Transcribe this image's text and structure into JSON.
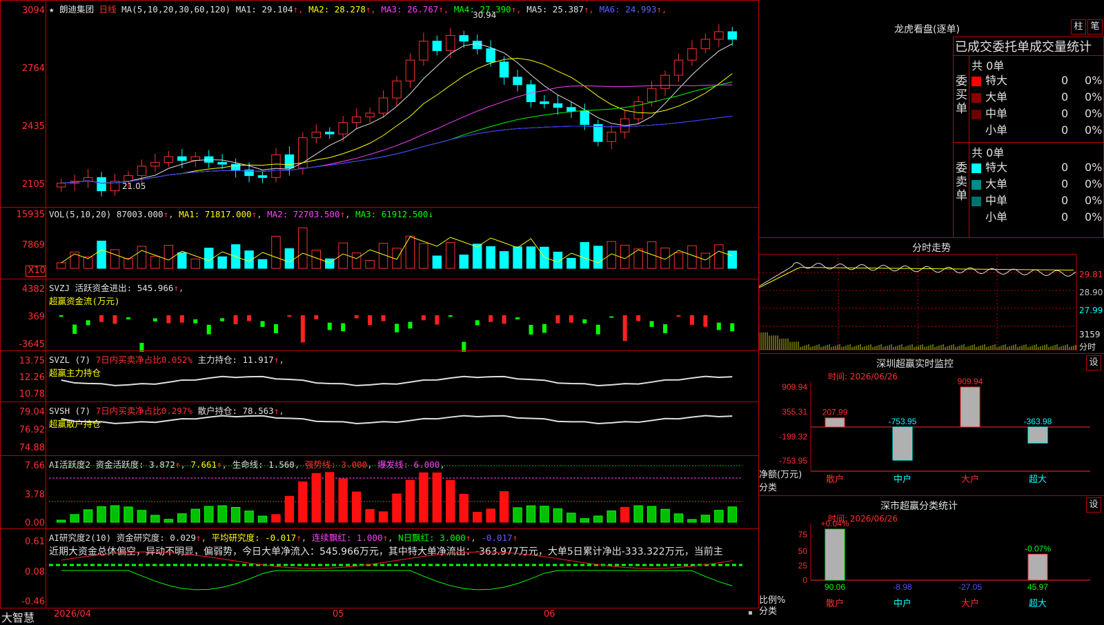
{
  "stock": {
    "star": "★",
    "name": "朗迪集团",
    "period": "日线"
  },
  "main": {
    "ma_label": "MA(5,10,20,30,60,120)",
    "ma": [
      {
        "k": "MA1:",
        "v": "29.104",
        "cls": "w"
      },
      {
        "k": "MA2:",
        "v": "28.278",
        "cls": "y"
      },
      {
        "k": "MA3:",
        "v": "26.767",
        "cls": "m"
      },
      {
        "k": "MA4:",
        "v": "27.390",
        "cls": "g"
      },
      {
        "k": "MA5:",
        "v": "25.387",
        "cls": "w"
      },
      {
        "k": "MA6:",
        "v": "24.993",
        "cls": "b"
      }
    ],
    "yticks": [
      "3094",
      "2764",
      "2435",
      "2105"
    ],
    "high_label": "30.94",
    "low_label": "21.05"
  },
  "vol": {
    "label": "VOL(5,10,20)",
    "val": "87003.000",
    "ma1": "MA1: 71817.000",
    "ma2": "MA2: 72703.500",
    "ma3": "MA3: 61912.500",
    "yticks": [
      "15935",
      "7869"
    ],
    "unit": "X10"
  },
  "svzj": {
    "label": "SVZJ",
    "title": "活跃资金进出: 545.966",
    "sub": "超赢资金流(万元)",
    "yticks": [
      "4382",
      "369",
      "-3645"
    ]
  },
  "svzl": {
    "label": "SVZL (7)",
    "red": "7日内买卖净占比0.052%",
    "main": "主力持仓: 11.917",
    "sub": "超赢主力持仓",
    "yticks": [
      "13.75",
      "12.26",
      "10.78"
    ]
  },
  "svsh": {
    "label": "SVSH (7)",
    "red": "7日内买卖净占比0.297%",
    "main": "散户持仓: 78.563",
    "sub": "超赢散户持仓",
    "yticks": [
      "79.04",
      "76.92",
      "74.88"
    ]
  },
  "ai1": {
    "label": "AI活跃度2",
    "a": "资金活跃度: 3.872",
    "b": "7.661",
    "c": "生命线: 1.560",
    "d": "强势线: 3.000",
    "e": "爆发线: 6.000",
    "yticks": [
      "7.66",
      "3.78",
      "0.00"
    ]
  },
  "ai2": {
    "label": "AI研究度2(10)",
    "a": "资金研究度: 0.029",
    "b": "平均研究度: -0.017",
    "c": "连续飘红: 1.000",
    "d": "N日飘红: 3.000",
    "e": "-0.017",
    "text": "近期大资金总体偏空，异动不明显，偏弱势，今日大单净流入：545.966万元，其中特大单净流出：-363.977万元，大单5日累计净出-333.322万元，当前主",
    "yticks": [
      "0.61",
      "0.08",
      "-0.46"
    ]
  },
  "footer": {
    "brand": "大智慧",
    "d1": "2026/04",
    "d2": "05",
    "d3": "06"
  },
  "lh": {
    "title": "龙虎看盘(逐单)",
    "btn1": "柱",
    "btn2": "笔",
    "stat": "已成交委托单成交量统计",
    "buy_label": "委买单",
    "sell_label": "委卖单",
    "buy_total": "共 0单",
    "sell_total": "共 0单",
    "buy": [
      {
        "n": "特大",
        "c": "#ff0000",
        "v": "0",
        "p": "0%"
      },
      {
        "n": "大单",
        "c": "#8b0000",
        "v": "0",
        "p": "0%"
      },
      {
        "n": "中单",
        "c": "#6a0000",
        "v": "0",
        "p": "0%"
      },
      {
        "n": "小单",
        "c": "#000000",
        "v": "0",
        "p": "0%"
      }
    ],
    "sell": [
      {
        "n": "特大",
        "c": "#00ffff",
        "v": "0",
        "p": "0%"
      },
      {
        "n": "大单",
        "c": "#008b8b",
        "v": "0",
        "p": "0%"
      },
      {
        "n": "中单",
        "c": "#007070",
        "v": "0",
        "p": "0%"
      },
      {
        "n": "小单",
        "c": "#000000",
        "v": "0",
        "p": "0%"
      }
    ]
  },
  "fs": {
    "title": "分时走势",
    "p1": "29.81",
    "p2": "28.90",
    "p3": "27.99",
    "v": "3159",
    "unit": "分时"
  },
  "sz": {
    "title": "深圳超赢实时监控",
    "btn": "设",
    "time": "时间: 2026/06/26",
    "yticks": [
      "909.94",
      "355.31",
      "-199.32",
      "-753.95"
    ],
    "ylabel": "净额(万元)",
    "xlabel": "分类",
    "cats": [
      "散户",
      "中户",
      "大户",
      "超大"
    ],
    "vals": [
      "207.99",
      "-753.95",
      "909.94",
      "-363.98"
    ]
  },
  "ss": {
    "title": "深市超赢分类统计",
    "btn": "设",
    "time": "时间: 2026/06/26",
    "yticks": [
      "75",
      "50",
      "25",
      "0"
    ],
    "ylabel": "比例%",
    "xlabel": "分类",
    "cats": [
      "散户",
      "中户",
      "大户",
      "超大"
    ],
    "top": [
      "+0.04%",
      "",
      "",
      "-0.07%"
    ],
    "bot": [
      "90.06",
      "-8.98",
      "-27.05",
      "45.97"
    ]
  },
  "chart_data": {
    "type": "candlestick",
    "title": "朗迪集团 日线",
    "ylim": [
      21.05,
      30.94
    ],
    "closes": [
      22.0,
      22.1,
      22.3,
      21.6,
      22.1,
      22.4,
      22.9,
      23.1,
      23.4,
      23.2,
      23.4,
      23.1,
      23.0,
      22.7,
      22.4,
      22.3,
      23.5,
      22.8,
      24.4,
      24.7,
      24.6,
      25.2,
      25.5,
      25.7,
      26.5,
      27.4,
      28.5,
      29.5,
      29.0,
      29.8,
      29.5,
      29.1,
      28.4,
      27.6,
      27.2,
      26.3,
      26.2,
      26.0,
      25.8,
      25.1,
      24.2,
      24.7,
      25.4,
      26.3,
      27.0,
      27.7,
      28.5,
      29.1,
      29.6,
      30.0,
      29.6
    ]
  }
}
